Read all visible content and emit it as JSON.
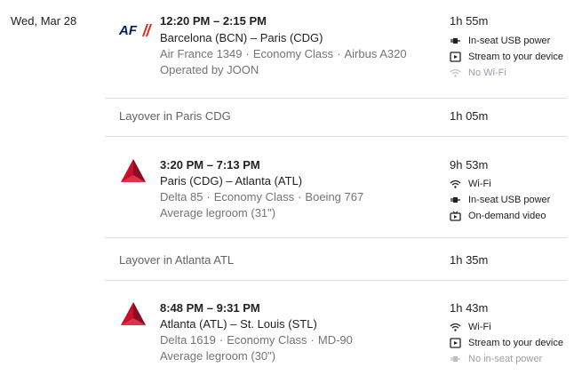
{
  "date": "Wed, Mar 28",
  "segments": [
    {
      "times": "12:20 PM – 2:15 PM",
      "route": "Barcelona (BCN) – Paris (CDG)",
      "flight": "Air France 1349",
      "cabin": "Economy Class",
      "aircraft": "Airbus A320",
      "extra": "Operated by JOON",
      "duration": "1h 55m",
      "airline_logo": "airfrance-logo",
      "logo_text": "AF",
      "amenities": [
        {
          "icon": "power-plug-icon",
          "label": "In-seat USB power",
          "available": true
        },
        {
          "icon": "stream-device-icon",
          "label": "Stream to your device",
          "available": true
        },
        {
          "icon": "wifi-icon",
          "label": "No Wi-Fi",
          "available": false
        }
      ]
    },
    {
      "times": "3:20 PM – 7:13 PM",
      "route": "Paris (CDG) – Atlanta (ATL)",
      "flight": "Delta 85",
      "cabin": "Economy Class",
      "aircraft": "Boeing 767",
      "extra": "Average legroom (31\")",
      "duration": "9h 53m",
      "airline_logo": "delta-logo",
      "amenities": [
        {
          "icon": "wifi-icon",
          "label": "Wi-Fi",
          "available": true
        },
        {
          "icon": "power-plug-icon",
          "label": "In-seat USB power",
          "available": true
        },
        {
          "icon": "tv-icon",
          "label": "On-demand video",
          "available": true
        }
      ]
    },
    {
      "times": "8:48 PM – 9:31 PM",
      "route": "Atlanta (ATL) – St. Louis (STL)",
      "flight": "Delta 1619",
      "cabin": "Economy Class",
      "aircraft": "MD-90",
      "extra": "Average legroom (30\")",
      "duration": "1h 43m",
      "airline_logo": "delta-logo",
      "amenities": [
        {
          "icon": "wifi-icon",
          "label": "Wi-Fi",
          "available": true
        },
        {
          "icon": "stream-device-icon",
          "label": "Stream to your device",
          "available": true
        },
        {
          "icon": "power-plug-icon",
          "label": "No in-seat power",
          "available": false
        }
      ]
    }
  ],
  "layovers": [
    {
      "label": "Layover in Paris CDG",
      "duration": "1h 05m"
    },
    {
      "label": "Layover in Atlanta ATL",
      "duration": "1h 35m"
    }
  ],
  "colors": {
    "airfrance_navy": "#002157",
    "airfrance_red": "#e2231a",
    "delta_red": "#c8102e",
    "text_primary": "#202124",
    "text_secondary": "#70757a",
    "text_disabled": "#9aa0a6",
    "divider": "#dadce0"
  }
}
